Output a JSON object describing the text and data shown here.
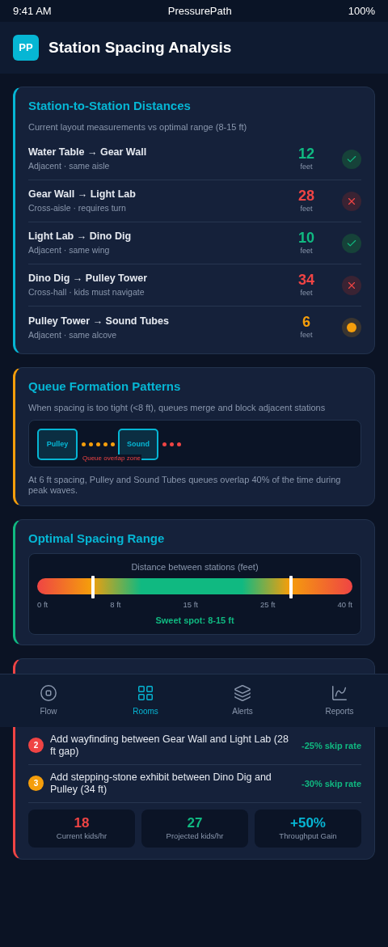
{
  "status_bar": {
    "time": "9:41 AM",
    "app": "PressurePath",
    "battery": "100%"
  },
  "header": {
    "logo": "PP",
    "title": "Station Spacing Analysis"
  },
  "distances": {
    "title": "Station-to-Station Distances",
    "subtitle": "Current layout measurements vs optimal range (8-15 ft)",
    "rows": [
      {
        "route": "Water Table → Gear Wall",
        "detail": "Adjacent · same aisle",
        "value": "12",
        "unit": "feet",
        "kind": "good"
      },
      {
        "route": "Gear Wall → Light Lab",
        "detail": "Cross-aisle · requires turn",
        "value": "28",
        "unit": "feet",
        "kind": "bad"
      },
      {
        "route": "Light Lab → Dino Dig",
        "detail": "Adjacent · same wing",
        "value": "10",
        "unit": "feet",
        "kind": "good"
      },
      {
        "route": "Dino Dig → Pulley Tower",
        "detail": "Cross-hall · kids must navigate",
        "value": "34",
        "unit": "feet",
        "kind": "bad"
      },
      {
        "route": "Pulley Tower → Sound Tubes",
        "detail": "Adjacent · same alcove",
        "value": "6",
        "unit": "feet",
        "kind": "warn"
      }
    ]
  },
  "queues": {
    "title": "Queue Formation Patterns",
    "subtitle": "When spacing is too tight (<8 ft), queues merge and block adjacent stations",
    "stations": [
      {
        "label": "Pulley",
        "color": "#f59e0b"
      },
      {
        "label": "Sound",
        "color": "#ef4444"
      }
    ],
    "overlap_label": "Queue overlap zone",
    "note": "At 6 ft spacing, Pulley and Sound Tubes queues overlap 40% of the time during peak waves."
  },
  "range": {
    "title": "Optimal Spacing Range",
    "caption": "Distance between stations (feet)",
    "markers": [
      {
        "level": 0.176
      },
      {
        "level": 0.806
      }
    ],
    "ticks": [
      "0 ft",
      "8 ft",
      "15 ft",
      "25 ft",
      "40 ft"
    ],
    "sweet_spot": "Sweet spot: 8-15 ft"
  },
  "recommendations": {
    "items": [
      {
        "number": "2",
        "text": "Add wayfinding between Gear Wall and Light Lab (28 ft gap)",
        "effect": "-25% skip rate",
        "color": "#ef4444"
      },
      {
        "number": "3",
        "text": "Add stepping-stone exhibit between Dino Dig and Pulley (34 ft)",
        "effect": "-30% skip rate",
        "color": "#f59e0b"
      }
    ],
    "stats": [
      {
        "value": "18",
        "label": "Current kids/hr",
        "color": "#ef4444"
      },
      {
        "value": "27",
        "label": "Projected kids/hr",
        "color": "#10b981"
      },
      {
        "value": "+50%",
        "label": "Throughput Gain",
        "color": "#06b6d4"
      }
    ]
  },
  "nav": [
    {
      "label": "Flow",
      "selected": false
    },
    {
      "label": "Rooms",
      "selected": true
    },
    {
      "label": "Alerts",
      "selected": false
    },
    {
      "label": "Reports",
      "selected": false
    }
  ]
}
